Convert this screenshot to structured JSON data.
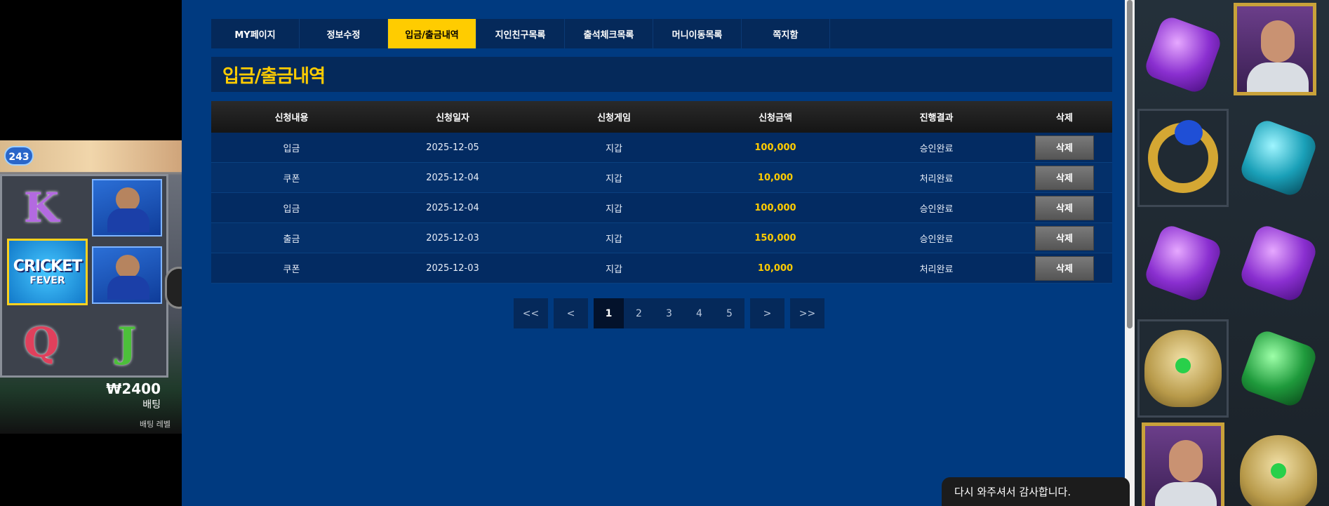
{
  "left_banner": {
    "ways_label": "243",
    "logo_line1": "CRICKET",
    "logo_line2": "FEVER",
    "bet_amount": "₩2400",
    "bet_label": "배팅",
    "footer_text": "배팅 레벨"
  },
  "tabs": [
    {
      "label": "MY페이지",
      "active": false
    },
    {
      "label": "정보수정",
      "active": false
    },
    {
      "label": "입금/출금내역",
      "active": true
    },
    {
      "label": "지인친구목록",
      "active": false
    },
    {
      "label": "출석체크목록",
      "active": false
    },
    {
      "label": "머니이동목록",
      "active": false
    },
    {
      "label": "쪽지함",
      "active": false
    }
  ],
  "page_title": "입금/출금내역",
  "table": {
    "headers": [
      "신청내용",
      "신청일자",
      "신청게임",
      "신청금액",
      "진행결과",
      "삭제"
    ],
    "rows": [
      {
        "type": "입금",
        "date": "2025-12-05",
        "game": "지갑",
        "amount": "100,000",
        "result": "승인완료",
        "action": "삭제"
      },
      {
        "type": "쿠폰",
        "date": "2025-12-04",
        "game": "지갑",
        "amount": "10,000",
        "result": "처리완료",
        "action": "삭제"
      },
      {
        "type": "입금",
        "date": "2025-12-04",
        "game": "지갑",
        "amount": "100,000",
        "result": "승인완료",
        "action": "삭제"
      },
      {
        "type": "출금",
        "date": "2025-12-03",
        "game": "지갑",
        "amount": "150,000",
        "result": "승인완료",
        "action": "삭제"
      },
      {
        "type": "쿠폰",
        "date": "2025-12-03",
        "game": "지갑",
        "amount": "10,000",
        "result": "처리완료",
        "action": "삭제"
      }
    ]
  },
  "pagination": {
    "first": "<<",
    "prev": "<",
    "pages": [
      "1",
      "2",
      "3",
      "4",
      "5"
    ],
    "current": "1",
    "next": ">",
    "last": ">>"
  },
  "toast": "다시 와주셔서 감사합니다.",
  "colors": {
    "background": "#003a80",
    "accent": "#ffcc00",
    "panel": "#05295a"
  }
}
